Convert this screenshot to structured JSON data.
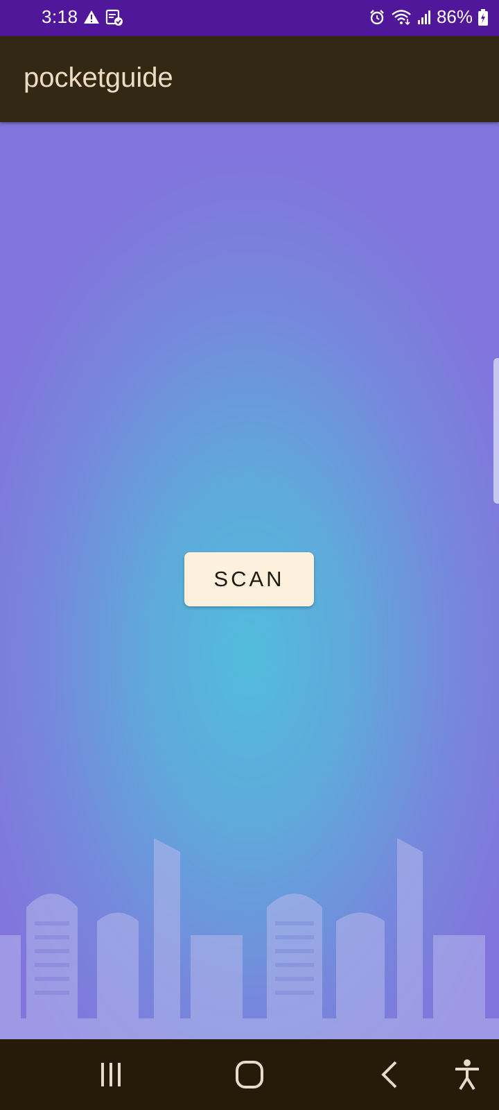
{
  "status_bar": {
    "time": "3:18",
    "battery_percent": "86%",
    "left_icons": [
      "warning-icon",
      "notes-check-icon"
    ],
    "right_icons": [
      "alarm-icon",
      "wifi-icon",
      "signal-icon",
      "battery-charging-icon"
    ],
    "background_color": "#51179a"
  },
  "app_bar": {
    "title": "pocketguide",
    "background_color": "#332814",
    "title_color": "#efdcc0"
  },
  "main": {
    "scan_button_label": "SCAN",
    "button_color": "#fdf1dd"
  },
  "nav_bar": {
    "buttons": [
      "recent-apps-icon",
      "home-icon",
      "back-icon",
      "accessibility-icon"
    ],
    "background_color": "#261a08"
  }
}
